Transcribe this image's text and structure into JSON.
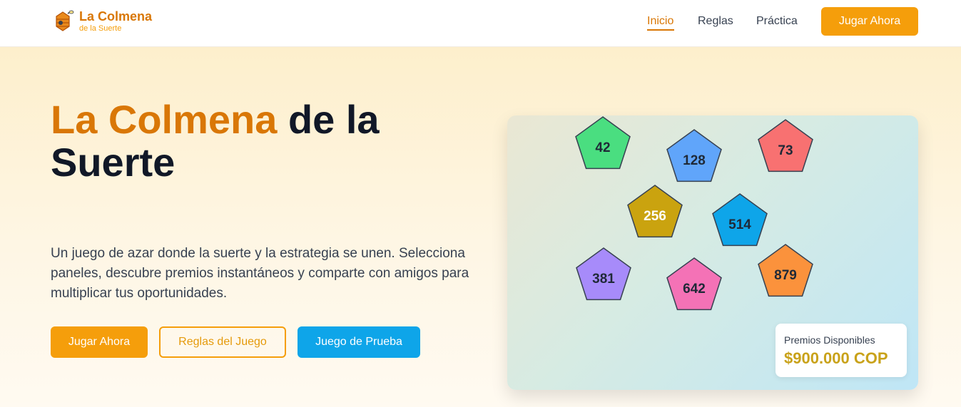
{
  "brand": {
    "title": "La Colmena",
    "subtitle": "de la Suerte",
    "icon": "beehive-icon"
  },
  "nav": {
    "links": [
      "Inicio",
      "Reglas",
      "Práctica"
    ],
    "active": "Inicio",
    "cta": "Jugar Ahora"
  },
  "hero": {
    "title_accent": "La Colmena",
    "title_rest": " de la Suerte",
    "description": "Un juego de azar donde la suerte y la estrategia se unen. Selecciona paneles, descubre premios instantáneos y comparte con amigos para multiplicar tus oportunidades.",
    "buttons": {
      "play": "Jugar Ahora",
      "rules": "Reglas del Juego",
      "practice": "Juego de Prueba"
    }
  },
  "game": {
    "panels": [
      {
        "number": "42",
        "color": "#4ade80",
        "text_color": "#1f2937"
      },
      {
        "number": "128",
        "color": "#60a5fa",
        "text_color": "#1f2937"
      },
      {
        "number": "73",
        "color": "#f87171",
        "text_color": "#1f2937"
      },
      {
        "number": "256",
        "color": "#caa30f",
        "text_color": "#ffffff"
      },
      {
        "number": "514",
        "color": "#0ea5e9",
        "text_color": "#1f2937"
      },
      {
        "number": "381",
        "color": "#a78bfa",
        "text_color": "#1f2937"
      },
      {
        "number": "642",
        "color": "#f472b6",
        "text_color": "#1f2937"
      },
      {
        "number": "879",
        "color": "#fb923c",
        "text_color": "#1f2937"
      }
    ],
    "prize": {
      "label": "Premios Disponibles",
      "value": "$900.000 COP"
    }
  },
  "colors": {
    "accent": "#d97706",
    "primary_button": "#f59e0b",
    "blue_button": "#0ea5e9"
  }
}
